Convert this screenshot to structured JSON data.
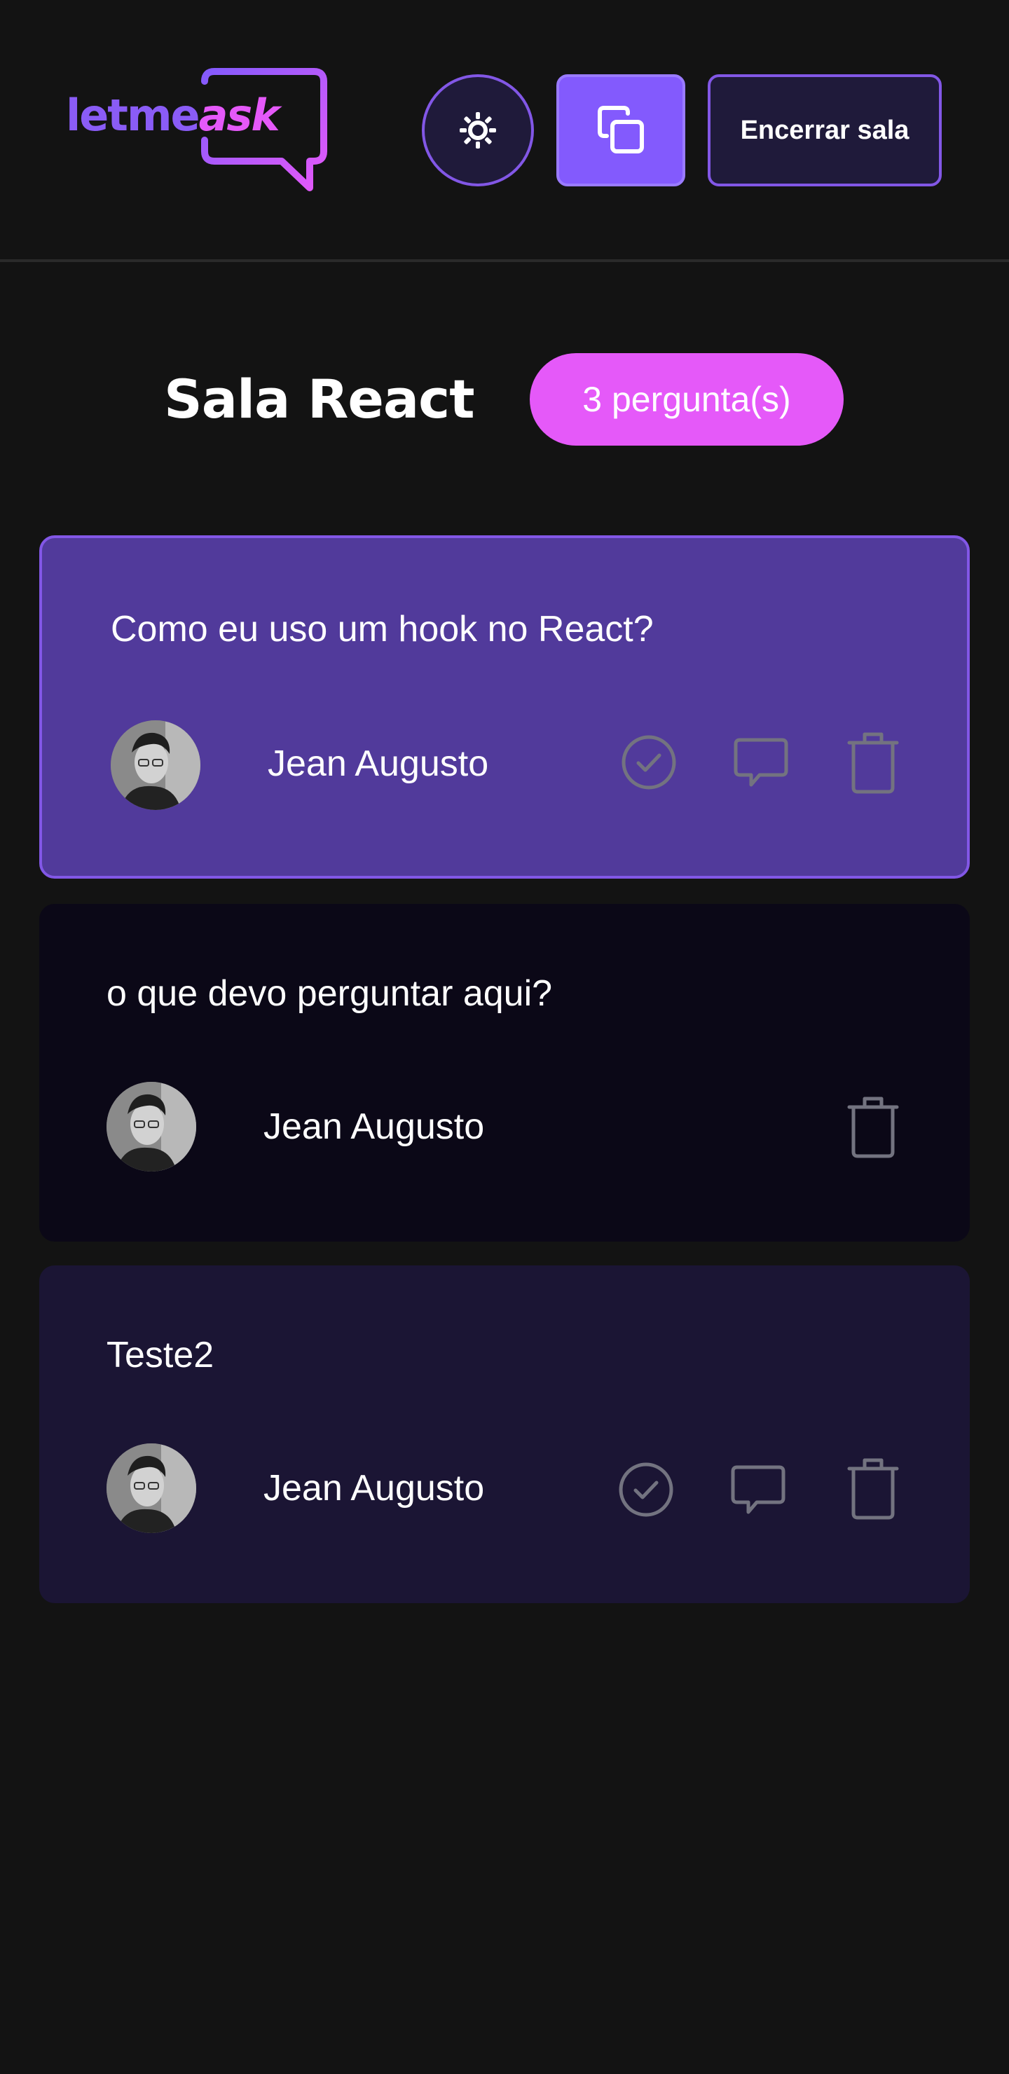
{
  "header": {
    "logo": {
      "text_part1": "letme",
      "text_part2": "ask"
    },
    "theme_icon": "sun-icon",
    "copy_icon": "copy-icon",
    "close_label": "Encerrar sala"
  },
  "room": {
    "title": "Sala React",
    "question_count": "3 pergunta(s)"
  },
  "questions": [
    {
      "content": "Como eu uso um hook no React?",
      "author": "Jean Augusto",
      "state": "highlighted",
      "actions": [
        "check-icon",
        "chat-bubble-icon",
        "trash-icon"
      ]
    },
    {
      "content": "o que devo perguntar aqui?",
      "author": "Jean Augusto",
      "state": "answered",
      "actions": [
        "trash-icon"
      ]
    },
    {
      "content": "Teste2",
      "author": "Jean Augusto",
      "state": "normal",
      "actions": [
        "check-icon",
        "chat-bubble-icon",
        "trash-icon"
      ]
    }
  ],
  "colors": {
    "background": "#131313",
    "primary": "#835afd",
    "pink": "#e559f9",
    "highlight_card": "#513a9b",
    "answered_card": "#0b0817",
    "normal_card": "#1b1534",
    "icon_gray": "#737380"
  }
}
